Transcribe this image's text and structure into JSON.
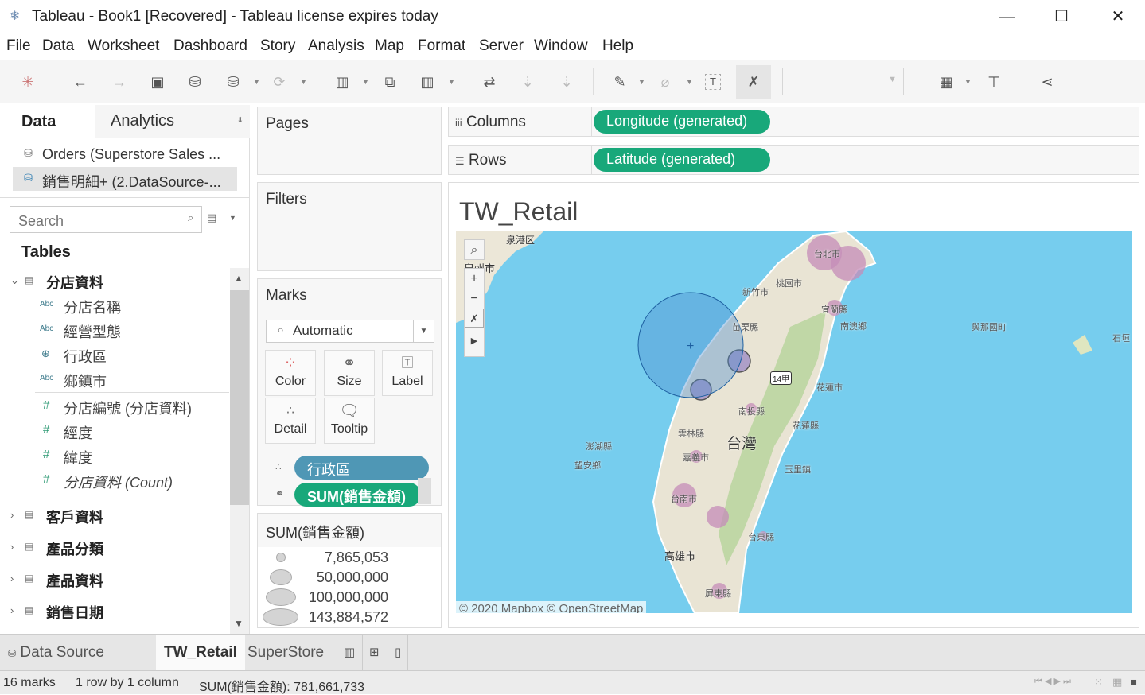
{
  "window": {
    "title": "Tableau - Book1 [Recovered] - Tableau license expires today",
    "app_icon": "tableau-logo-icon",
    "controls": {
      "minimize": "—",
      "maximize": "☐",
      "close": "✕"
    }
  },
  "menu": [
    "File",
    "Data",
    "Worksheet",
    "Dashboard",
    "Story",
    "Analysis",
    "Map",
    "Format",
    "Server",
    "Window",
    "Help"
  ],
  "toolbar": {
    "icons": [
      "tableau-logo-icon",
      "undo-icon",
      "redo-icon",
      "save-icon",
      "new-datasource-icon",
      "pause-updates-icon",
      "refresh-icon",
      "new-worksheet-icon",
      "duplicate-sheet-icon",
      "clear-sheet-icon",
      "swap-icon",
      "sort-ascending-icon",
      "sort-descending-icon",
      "highlight-icon",
      "group-icon",
      "show-labels-icon",
      "fix-axes-icon",
      "fit-dropdown",
      "show-me-icon",
      "presentation-icon",
      "share-icon"
    ],
    "fit_dropdown_value": ""
  },
  "left_panel": {
    "tabs": {
      "data": "Data",
      "analytics": "Analytics"
    },
    "datasources": [
      {
        "label": "Orders (Superstore Sales ...",
        "selected": false
      },
      {
        "label": "銷售明細+ (2.DataSource-...",
        "selected": true
      }
    ],
    "search_placeholder": "Search",
    "tables_heading": "Tables",
    "tables": [
      {
        "name": "分店資料",
        "expanded": true,
        "fields": [
          {
            "type": "Abc",
            "name": "分店名稱"
          },
          {
            "type": "Abc",
            "name": "經營型態"
          },
          {
            "type": "geo",
            "name": "行政區"
          },
          {
            "type": "Abc",
            "name": "鄉鎮市"
          },
          {
            "type": "#",
            "name": "分店編號 (分店資料)"
          },
          {
            "type": "#",
            "name": "經度"
          },
          {
            "type": "#",
            "name": "緯度"
          },
          {
            "type": "#",
            "name": "分店資料 (Count)"
          }
        ]
      },
      {
        "name": "客戶資料",
        "expanded": false
      },
      {
        "name": "產品分類",
        "expanded": false
      },
      {
        "name": "產品資料",
        "expanded": false
      },
      {
        "name": "銷售日期",
        "expanded": false
      }
    ]
  },
  "shelves": {
    "pages": "Pages",
    "filters": "Filters",
    "marks": {
      "heading": "Marks",
      "mark_type": "Automatic",
      "buttons": [
        "Color",
        "Size",
        "Label",
        "Detail",
        "Tooltip"
      ],
      "pills": [
        {
          "icon": "detail-icon",
          "label": "行政區",
          "color": "#4f97b5"
        },
        {
          "icon": "size-icon",
          "label": "SUM(銷售金額)",
          "color": "#18a87a"
        }
      ]
    },
    "columns": {
      "label": "Columns",
      "pill": "Longitude (generated)"
    },
    "rows": {
      "label": "Rows",
      "pill": "Latitude (generated)"
    }
  },
  "legend": {
    "title": "SUM(銷售金額)",
    "entries": [
      "7,865,053",
      "50,000,000",
      "100,000,000",
      "143,884,572"
    ]
  },
  "viz": {
    "title": "TW_Retail",
    "attribution": "© 2020 Mapbox © OpenStreetMap",
    "map_labels": [
      "泉港区",
      "泉州市",
      "新竹市",
      "桃園市",
      "台北市",
      "宜蘭縣",
      "南澳鄉",
      "苗栗縣",
      "與那國町",
      "石垣",
      "14甲",
      "花蓮市",
      "南投縣",
      "花蓮縣",
      "雲林縣",
      "台灣",
      "澎湖縣",
      "望安鄉",
      "嘉義市",
      "玉里鎮",
      "台南市",
      "高雄市",
      "台東縣",
      "屏東縣"
    ],
    "controls": [
      "search-icon",
      "zoom-in-icon",
      "zoom-out-icon",
      "unpin-icon",
      "expand-icon"
    ]
  },
  "sheet_tabs": {
    "data_source": "Data Source",
    "sheets": [
      {
        "label": "TW_Retail",
        "active": true
      },
      {
        "label": "SuperStore",
        "active": false
      }
    ],
    "new_icons": [
      "new-worksheet-icon",
      "new-dashboard-icon",
      "new-story-icon"
    ]
  },
  "status": {
    "marks": "16 marks",
    "dims": "1 row by 1 column",
    "sum": "SUM(銷售金額): 781,661,733"
  }
}
